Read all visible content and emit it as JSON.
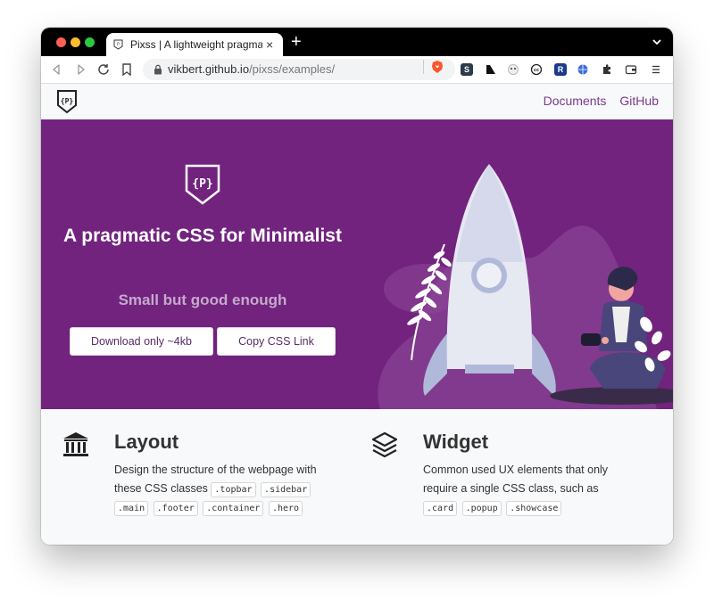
{
  "browser": {
    "tab_title": "Pixss | A lightweight pragmatic",
    "tab_close": "×",
    "new_tab": "+",
    "url_host": "vikbert.github.io",
    "url_path": "/pixss/examples/"
  },
  "site": {
    "nav": [
      "Documents",
      "GitHub"
    ],
    "hero": {
      "title": "A pragmatic CSS for Minimalist",
      "subtitle": "Small but good enough",
      "buttons": [
        "Download only ~4kb",
        "Copy CSS Link"
      ]
    },
    "features": [
      {
        "title": "Layout",
        "desc": "Design the structure of the webpage with these CSS classes",
        "tags": [
          ".topbar",
          ".sidebar",
          ".main",
          ".footer",
          ".container",
          ".hero"
        ],
        "icon": "bank-icon"
      },
      {
        "title": "Widget",
        "desc": "Common used UX elements that only require a single CSS class, such as",
        "tags": [
          ".card",
          ".popup",
          ".showcase"
        ],
        "icon": "layers-icon"
      }
    ]
  },
  "colors": {
    "hero_bg": "#71237e",
    "accent": "#7a3a8c",
    "subtitle": "#c6a9cd"
  }
}
